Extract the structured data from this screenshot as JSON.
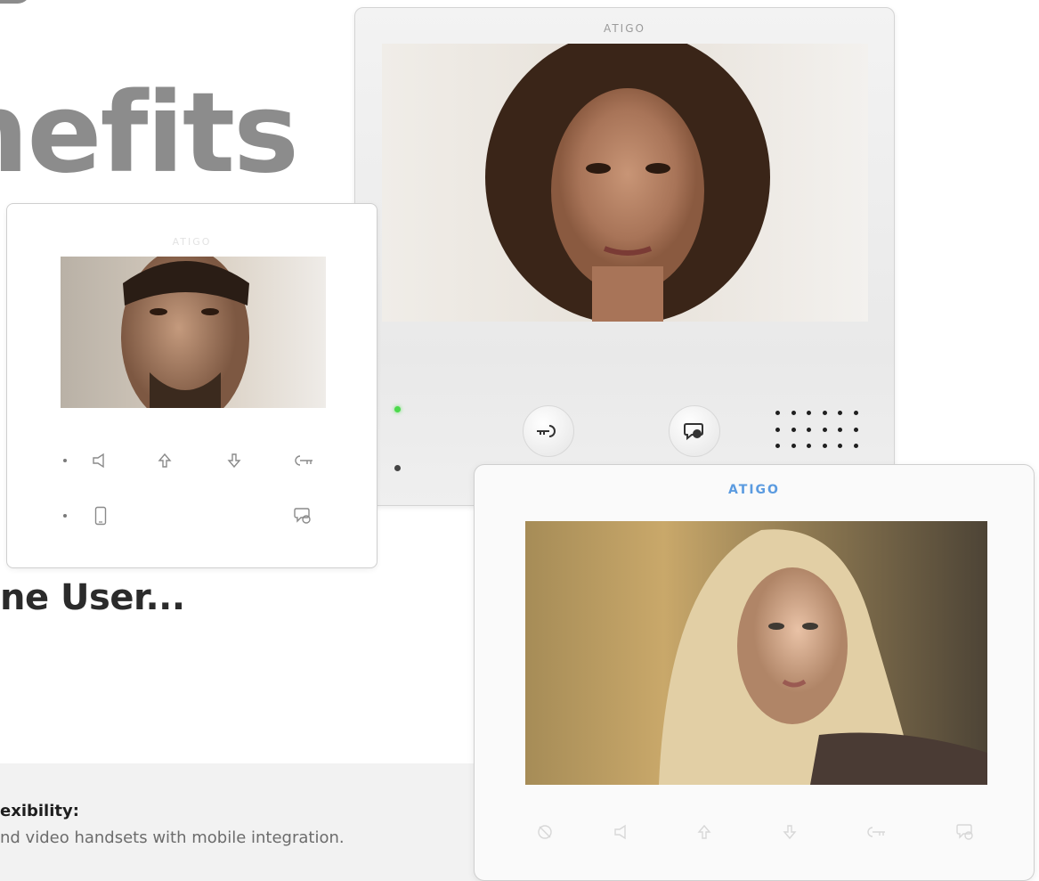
{
  "page": {
    "heading": "nefits",
    "subheading": "ne User...",
    "feature_title": "exibility:",
    "feature_text": "nd video handsets with mobile integration."
  },
  "monitors": {
    "large": {
      "brand": "ATIGO",
      "buttons": [
        "key-icon",
        "chat-bubble-icon"
      ]
    },
    "small": {
      "brand": "ATIGO",
      "icons": [
        "speaker-icon",
        "arrow-up-icon",
        "arrow-down-icon",
        "key-icon",
        "phone-icon",
        "chat-bubble-icon"
      ]
    },
    "wide": {
      "brand": "ATIGO",
      "icons": [
        "mute-icon",
        "speaker-icon",
        "arrow-up-icon",
        "arrow-down-icon",
        "key-icon",
        "chat-bubble-icon"
      ]
    }
  },
  "colors": {
    "heading": "#8c8c8c",
    "brand_blue": "#5b9be0",
    "led_green": "#4cd94c"
  }
}
